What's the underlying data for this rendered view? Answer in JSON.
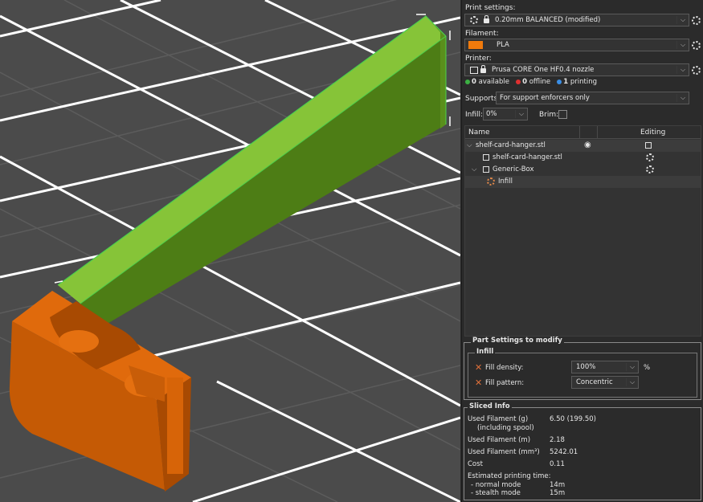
{
  "sidebar": {
    "print_settings": {
      "label": "Print settings:",
      "value": "0.20mm BALANCED (modified)"
    },
    "filament": {
      "label": "Filament:",
      "value": "PLA",
      "color": "#f07a0c"
    },
    "printer": {
      "label": "Printer:",
      "value": "Prusa CORE One HF0.4 nozzle",
      "status": [
        {
          "count": "0",
          "text": "available",
          "color": "#3cb043"
        },
        {
          "count": "0",
          "text": "offline",
          "color": "#e03030"
        },
        {
          "count": "1",
          "text": "printing",
          "color": "#3a8ee6"
        }
      ]
    },
    "supports": {
      "label": "Supports:",
      "value": "For support enforcers only"
    },
    "infill": {
      "label": "Infill:",
      "value": "0%"
    },
    "brim": {
      "label": "Brim:"
    }
  },
  "object_list": {
    "col_name": "Name",
    "col_editing": "Editing",
    "rows": [
      {
        "name": "shelf-card-hanger.stl",
        "icon": "eye-icon"
      },
      {
        "name": "shelf-card-hanger.stl",
        "icon": "part-icon"
      },
      {
        "name": "Generic-Box",
        "icon": "modifier-icon"
      },
      {
        "name": "Infill",
        "icon": "settings-icon"
      }
    ]
  },
  "part_settings": {
    "title": "Part Settings to modify",
    "group": "Infill",
    "fill_density": {
      "label": "Fill density:",
      "value": "100%",
      "unit": "%"
    },
    "fill_pattern": {
      "label": "Fill pattern:",
      "value": "Concentric"
    }
  },
  "sliced_info": {
    "title": "Sliced Info",
    "used_filament_g": {
      "label": "Used Filament (g)",
      "sub": "(including spool)",
      "value": "6.50 (199.50)"
    },
    "used_filament_m": {
      "label": "Used Filament (m)",
      "value": "2.18"
    },
    "used_filament_mm3": {
      "label": "Used Filament (mm³)",
      "value": "5242.01"
    },
    "cost": {
      "label": "Cost",
      "value": "0.11"
    },
    "est_time": {
      "label": "Estimated printing time:"
    },
    "normal_mode": {
      "label": "- normal mode",
      "value": "14m"
    },
    "stealth_mode": {
      "label": "- stealth mode",
      "value": "15m"
    }
  }
}
